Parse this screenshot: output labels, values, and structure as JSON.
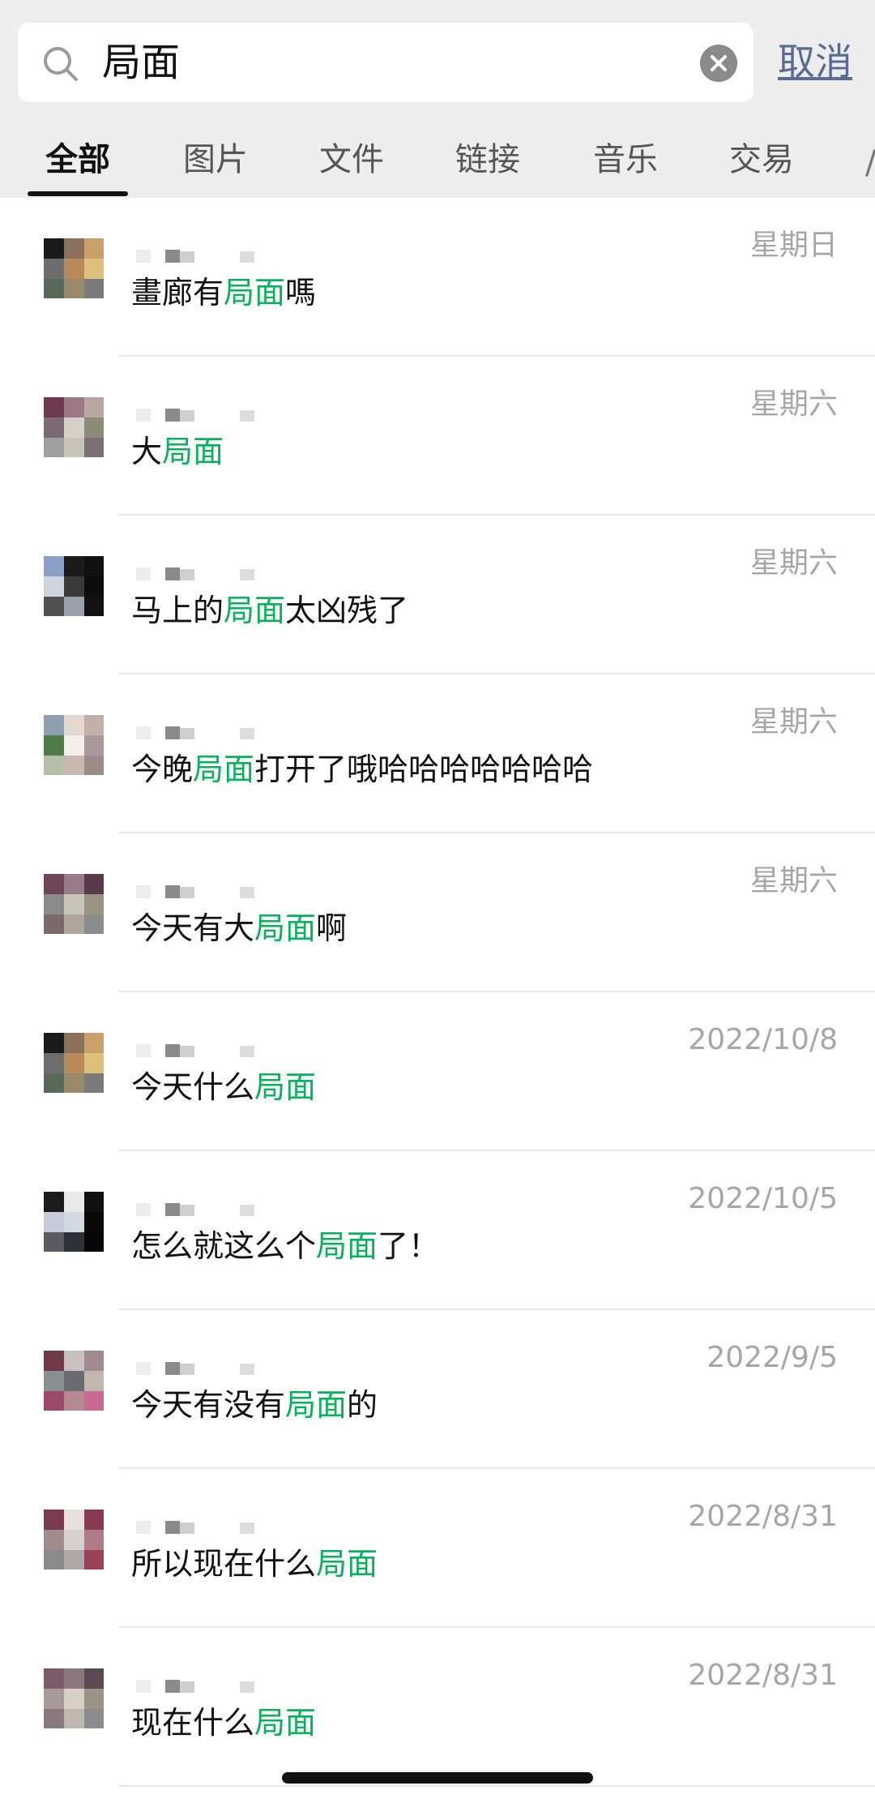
{
  "search": {
    "query": "局面",
    "cancel_label": "取消"
  },
  "tabs": [
    "全部",
    "图片",
    "文件",
    "链接",
    "音乐",
    "交易"
  ],
  "colors": {
    "highlight": "#07b35a",
    "link": "#576b95",
    "date": "#a6a6a6"
  },
  "results": [
    {
      "date": "星期日",
      "before": "畫廊有",
      "match": "局面",
      "after": "嗎"
    },
    {
      "date": "星期六",
      "before": "大",
      "match": "局面",
      "after": ""
    },
    {
      "date": "星期六",
      "before": "马上的",
      "match": "局面",
      "after": "太凶残了"
    },
    {
      "date": "星期六",
      "before": "今晚",
      "match": "局面",
      "after": "打开了哦哈哈哈哈哈哈哈"
    },
    {
      "date": "星期六",
      "before": "今天有大",
      "match": "局面",
      "after": "啊"
    },
    {
      "date": "2022/10/8",
      "before": "今天什么",
      "match": "局面",
      "after": ""
    },
    {
      "date": "2022/10/5",
      "before": "怎么就这么个",
      "match": "局面",
      "after": "了！"
    },
    {
      "date": "2022/9/5",
      "before": "今天有没有",
      "match": "局面",
      "after": "的"
    },
    {
      "date": "2022/8/31",
      "before": "所以现在什么",
      "match": "局面",
      "after": ""
    },
    {
      "date": "2022/8/31",
      "before": "现在什么",
      "match": "局面",
      "after": ""
    }
  ]
}
